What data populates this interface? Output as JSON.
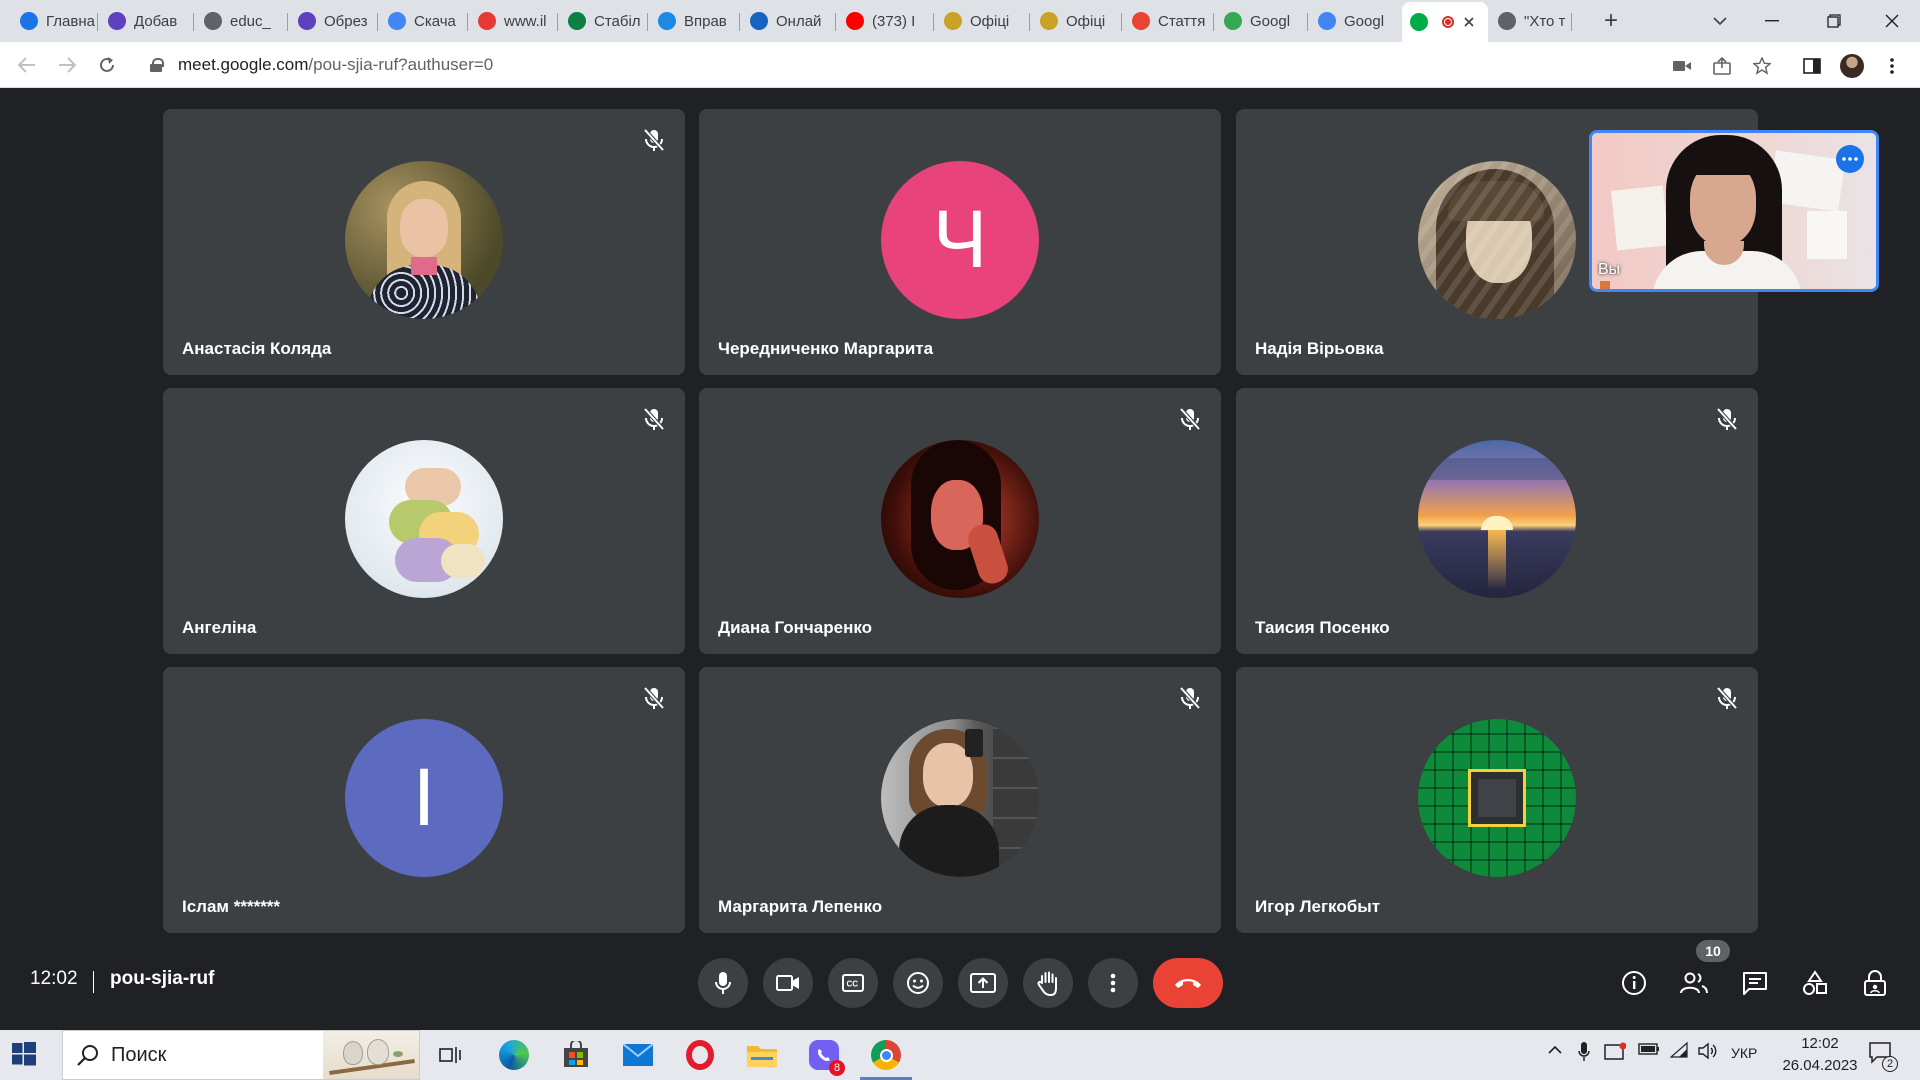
{
  "browser": {
    "tabs": [
      {
        "label": "Главна",
        "color": "#1a73e8"
      },
      {
        "label": "Добав",
        "color": "#5e3fbe"
      },
      {
        "label": "educ_",
        "color": "#5f6368"
      },
      {
        "label": "Обрез",
        "color": "#5e3fbe"
      },
      {
        "label": "Скача",
        "color": "#4285f4"
      },
      {
        "label": "www.il",
        "color": "#e53935"
      },
      {
        "label": "Стабіл",
        "color": "#0b8043"
      },
      {
        "label": "Вправ",
        "color": "#1e88e5"
      },
      {
        "label": "Онлай",
        "color": "#1565c0"
      },
      {
        "label": "(373) I",
        "color": "#ff0000"
      },
      {
        "label": "Офіці",
        "color": "#c9a227"
      },
      {
        "label": "Офіці",
        "color": "#c9a227"
      },
      {
        "label": "Стаття",
        "color": "#ea4335"
      },
      {
        "label": "Googl",
        "color": "#34a853"
      },
      {
        "label": "Googl",
        "color": "#4285f4"
      },
      {
        "label": "",
        "color": "#00ac47"
      },
      {
        "label": "\"Хто т",
        "color": "#5f6368"
      }
    ],
    "new_tab_symbol": "+",
    "url_host": "meet.google.com",
    "url_path": "/pou-sjia-ruf?authuser=0"
  },
  "participants": [
    {
      "name": "Анастасія Коляда",
      "avatar": "photo-girl-jacket",
      "muted": true
    },
    {
      "name": "Чередниченко Маргарита",
      "avatar": "letter",
      "letter": "Ч",
      "color": "#e8437a",
      "muted": false
    },
    {
      "name": "Надія Вірьовка",
      "avatar": "photo-sepia-girl",
      "muted": false
    },
    {
      "name": "Ангеліна",
      "avatar": "photo-macarons",
      "muted": true
    },
    {
      "name": "Диана Гончаренко",
      "avatar": "photo-red-portrait",
      "muted": true
    },
    {
      "name": "Таисия Посенко",
      "avatar": "photo-sunset-sea",
      "muted": true
    },
    {
      "name": "Іслам *******",
      "avatar": "letter",
      "letter": "І",
      "color": "#5c6bc0",
      "muted": true
    },
    {
      "name": "Маргарита Лепенко",
      "avatar": "photo-mirror-selfie",
      "muted": true
    },
    {
      "name": "Игор Легкобыт",
      "avatar": "photo-circuit-board",
      "muted": true
    }
  ],
  "self_view": {
    "label": "Вы"
  },
  "controls": {
    "time": "12:02",
    "meeting_code": "pou-sjia-ruf",
    "participants_count": "10"
  },
  "taskbar": {
    "search_placeholder": "Поиск",
    "viber_badge": "8",
    "language": "УКР",
    "time": "12:02",
    "date": "26.04.2023",
    "notifications": "2"
  }
}
